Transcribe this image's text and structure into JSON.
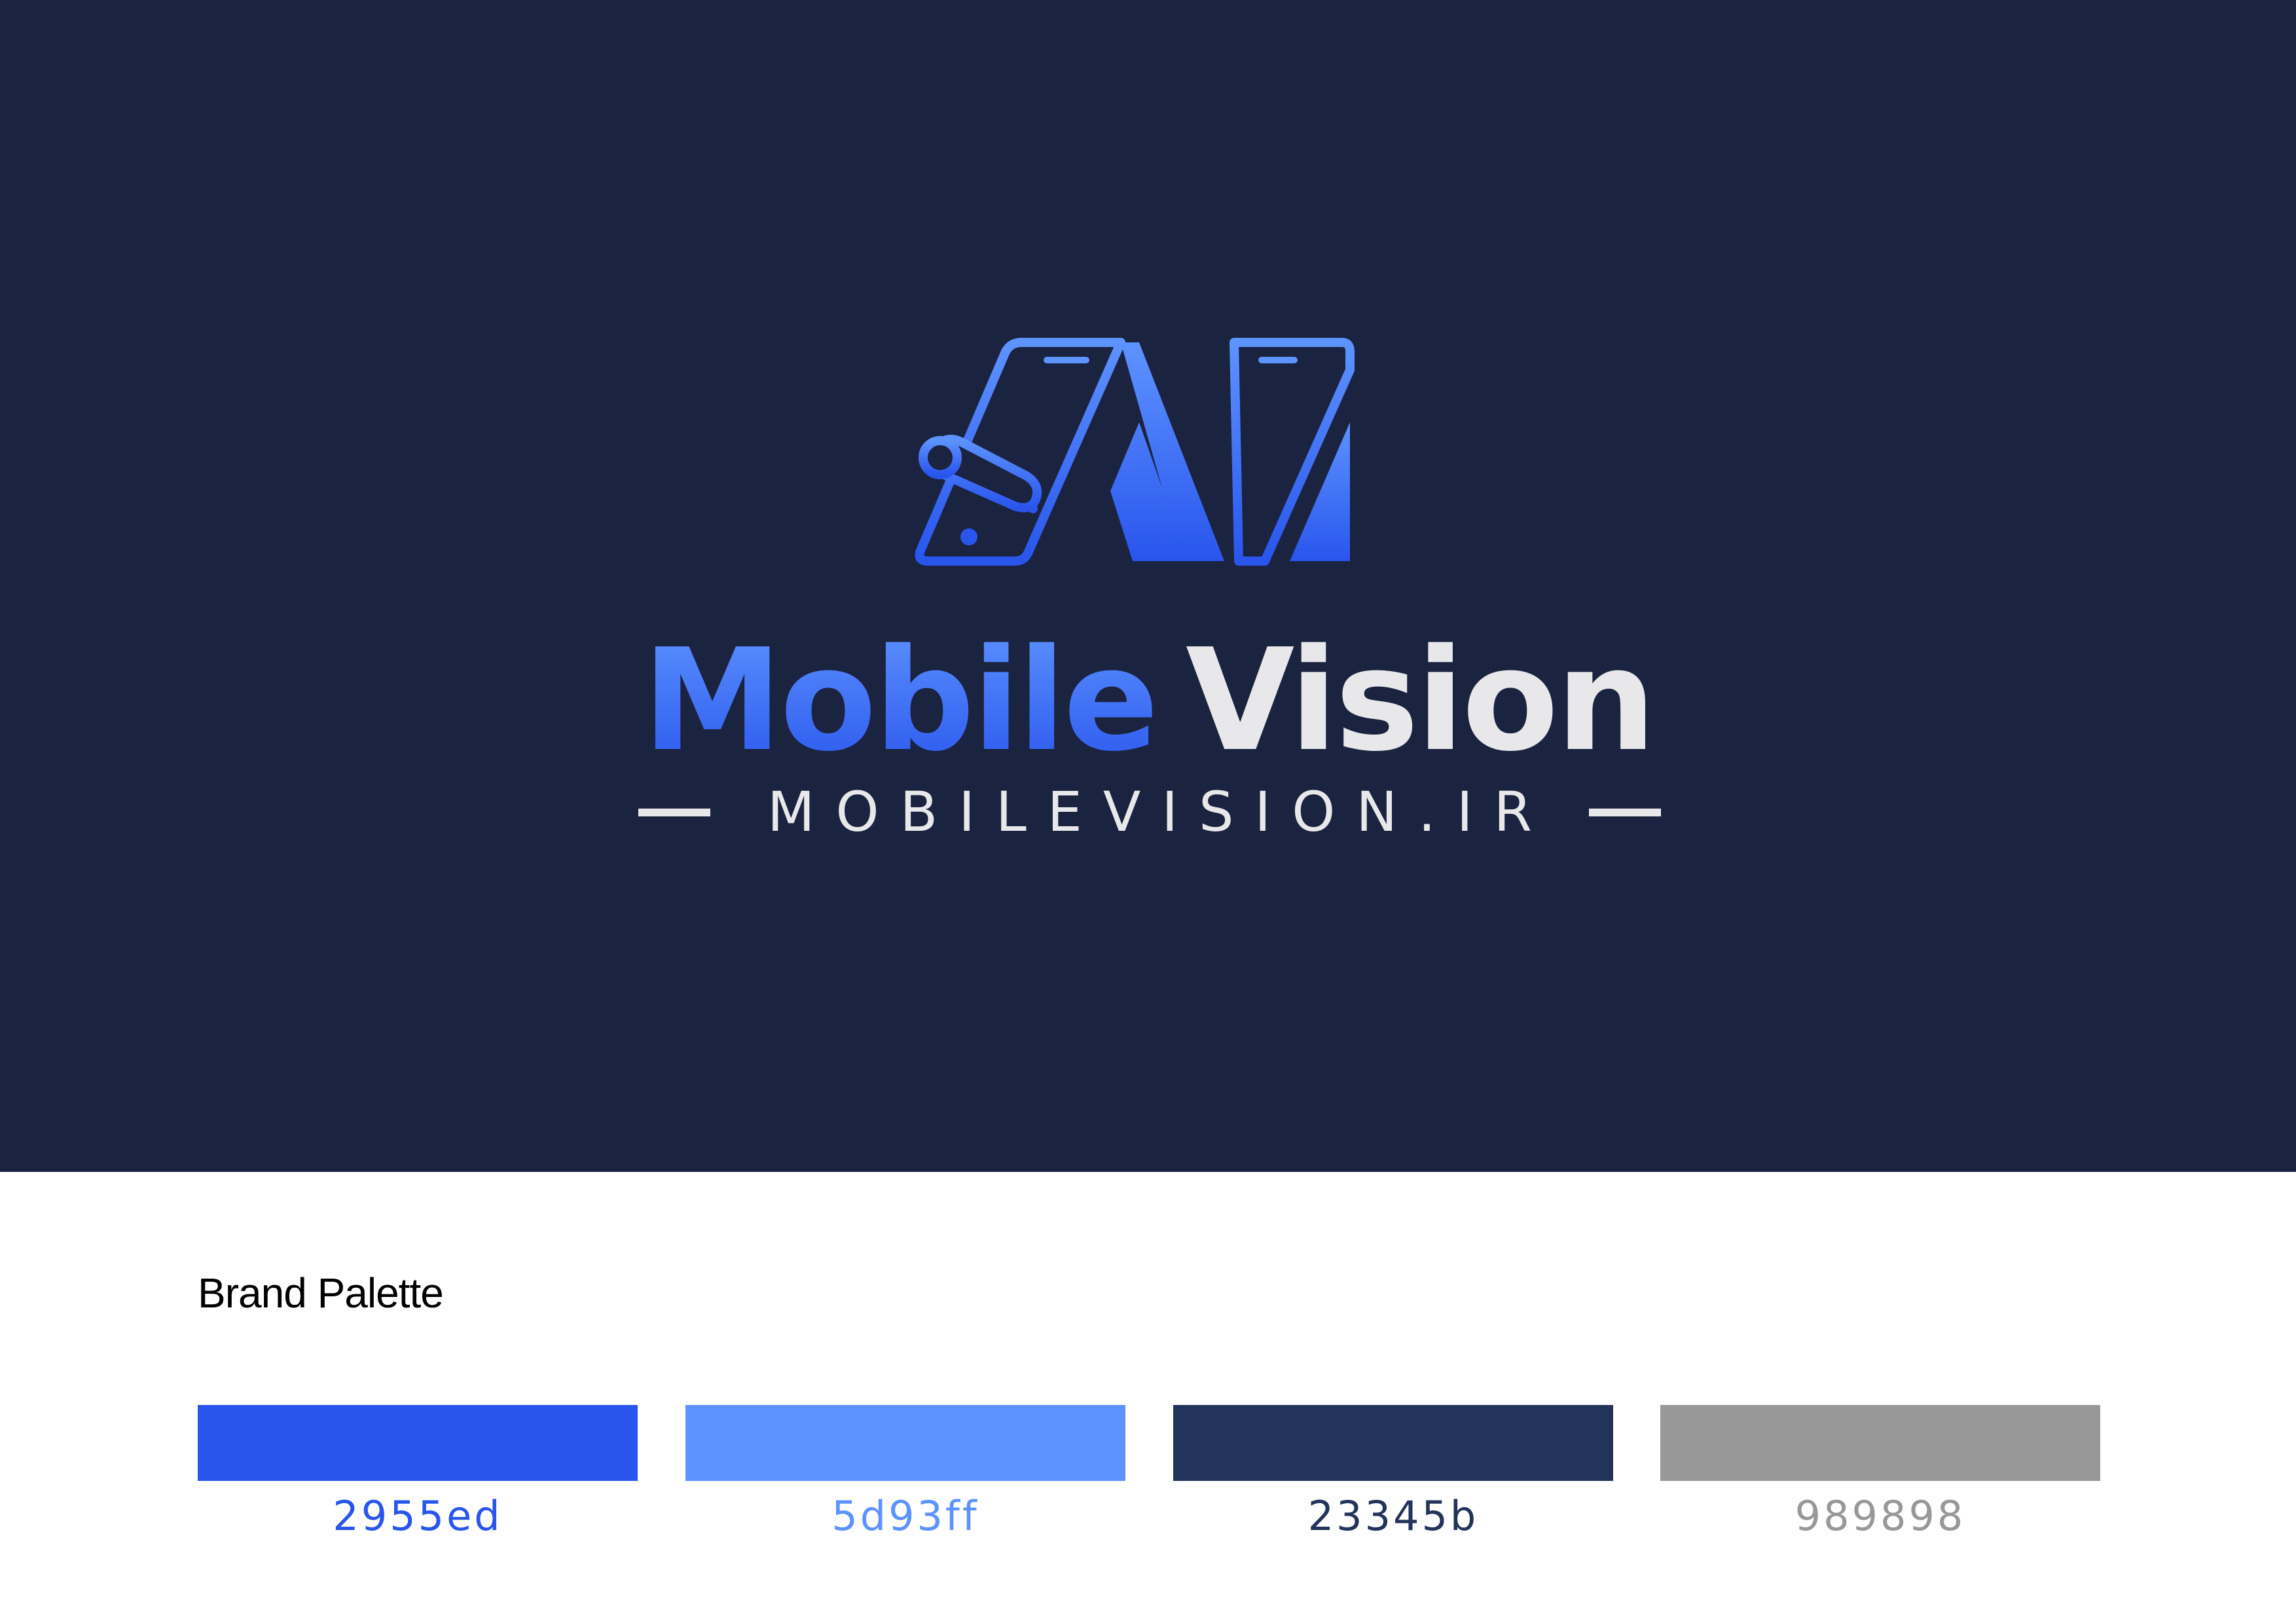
{
  "brand": {
    "name_part1": "Mobile",
    "name_part2": "Vision",
    "tagline": "MOBILEVISION.IR",
    "logo_icon": "phone-m-logo-icon"
  },
  "colors": {
    "background": "#1a2340",
    "wordmark_light": "#e8e8ea",
    "gradient_top": "#5d93ff",
    "gradient_bottom": "#2955ed"
  },
  "palette": {
    "title": "Brand Palette",
    "swatches": [
      {
        "code": "2955ed",
        "color": "#2955ed"
      },
      {
        "code": "5d93ff",
        "color": "#5d93ff"
      },
      {
        "code": "23345b",
        "color": "#23345b"
      },
      {
        "code": "989898",
        "color": "#989898"
      }
    ]
  }
}
